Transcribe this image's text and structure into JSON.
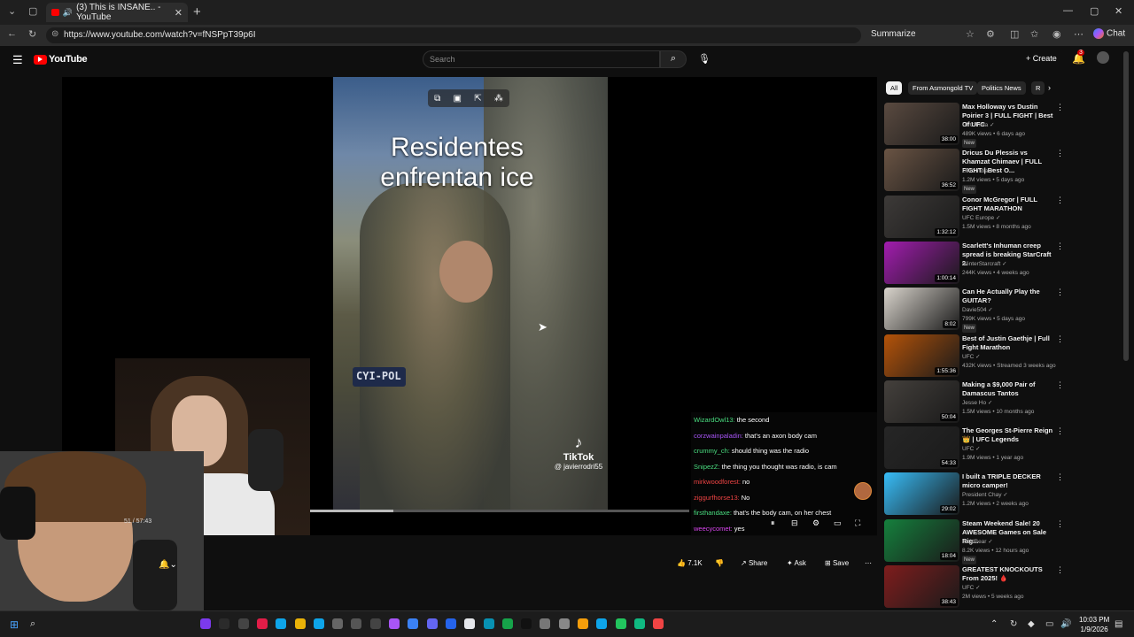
{
  "browser": {
    "tab_title": "(3) This is INSANE.. - YouTube",
    "url": "https://www.youtube.com/watch?v=fNSPpT39p6I",
    "summarize_label": "Summarize",
    "chat_label": "Chat"
  },
  "youtube": {
    "logo_text": "YouTube",
    "search_placeholder": "Search",
    "create_label": "Create",
    "notifications_count": "3"
  },
  "video": {
    "caption": "Residentes enfrentan ice",
    "plate_text": "CYI-POL",
    "watermark_brand": "TikTok",
    "watermark_handle": "@ javierrodri55",
    "timecode": "51 / 57:43",
    "progress_fraction": 0.22
  },
  "chat": [
    {
      "user": "WizardOwl13:",
      "text": "the second",
      "color": "#4ade80"
    },
    {
      "user": "corzwainpaladin:",
      "text": "that's an axon body cam",
      "color": "#a855f7"
    },
    {
      "user": "crummy_ch:",
      "text": "should thing was the radio",
      "color": "#4ade80"
    },
    {
      "user": "SnipezZ:",
      "text": "the thing you thought was radio, is cam",
      "color": "#4ade80"
    },
    {
      "user": "mirkwoodforest:",
      "text": "no",
      "color": "#ef4444"
    },
    {
      "user": "ziggurfhorse13:",
      "text": "No",
      "color": "#ef4444"
    },
    {
      "user": "firsthandaxe:",
      "text": "that's the body cam, on her chest",
      "color": "#4ade80"
    },
    {
      "user": "weecycomet:",
      "text": "yes",
      "color": "#d946ef"
    }
  ],
  "actions": {
    "likes": "7.1K",
    "share": "Share",
    "ask": "Ask",
    "save": "Save"
  },
  "chips": [
    "All",
    "From Asmongold TV",
    "Politics News",
    "R"
  ],
  "recommendations": [
    {
      "title": "Max Holloway vs Dustin Poirier 3 | FULL FIGHT | Best Of UFC",
      "channel": "UFC India",
      "stats": "489K views • 6 days ago",
      "badge": "New",
      "duration": "38:00",
      "color": "#5a4a40"
    },
    {
      "title": "Dricus Du Plessis vs Khamzat Chimaev | FULL FIGHT | Best O...",
      "channel": "UFC India",
      "stats": "1.2M views • 5 days ago",
      "badge": "New",
      "duration": "36:52",
      "color": "#6a5444"
    },
    {
      "title": "Conor McGregor | FULL FIGHT MARATHON",
      "channel": "UFC Europe",
      "stats": "1.5M views • 8 months ago",
      "badge": "",
      "duration": "1:32:12",
      "color": "#3d3a38"
    },
    {
      "title": "Scarlett's Inhuman creep spread is breaking StarCraft 2.",
      "channel": "WinterStarcraft",
      "stats": "244K views • 4 weeks ago",
      "badge": "",
      "duration": "1:00:14",
      "color": "#a21caf"
    },
    {
      "title": "Can He Actually Play the GUITAR?",
      "channel": "Davie504",
      "stats": "799K views • 5 days ago",
      "badge": "New",
      "duration": "8:02",
      "color": "#d9d4cc"
    },
    {
      "title": "Best of Justin Gaethje | Full Fight Marathon",
      "channel": "UFC",
      "stats": "432K views • Streamed 3 weeks ago",
      "badge": "",
      "duration": "1:55:36",
      "color": "#b45309"
    },
    {
      "title": "Making a $9,000 Pair of Damascus Tantos",
      "channel": "Jesse Ho",
      "stats": "1.5M views • 10 months ago",
      "badge": "",
      "duration": "50:04",
      "color": "#44403c"
    },
    {
      "title": "The Georges St-Pierre Reign 👑 | UFC Legends",
      "channel": "UFC",
      "stats": "1.9M views • 1 year ago",
      "badge": "",
      "duration": "54:33",
      "color": "#262626"
    },
    {
      "title": "I built a TRIPLE DECKER micro camper!",
      "channel": "President Chay",
      "stats": "1.2M views • 2 weeks ago",
      "badge": "",
      "duration": "29:02",
      "color": "#38bdf8"
    },
    {
      "title": "Steam Weekend Sale! 20 AWESOME Games on Sale Rig...",
      "channel": "GoldBear",
      "stats": "8.2K views • 12 hours ago",
      "badge": "New",
      "duration": "18:04",
      "color": "#15803d"
    },
    {
      "title": "GREATEST KNOCKOUTS From 2025! 🩸",
      "channel": "UFC",
      "stats": "2M views • 5 weeks ago",
      "badge": "",
      "duration": "38:43",
      "color": "#7f1d1d"
    }
  ],
  "taskbar": {
    "time": "10:03 PM",
    "date": "1/9/2026"
  }
}
